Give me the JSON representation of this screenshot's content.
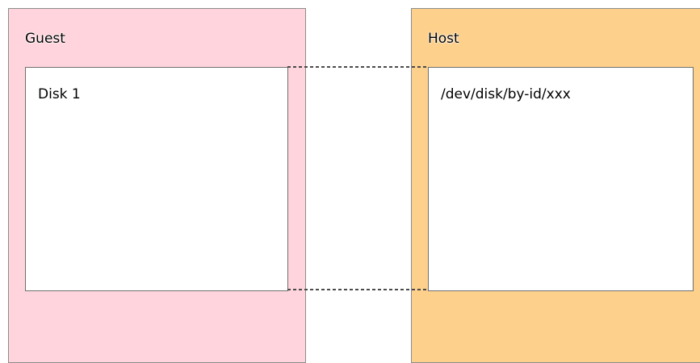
{
  "guest": {
    "title": "Guest",
    "disk_label": "Disk 1",
    "color": "#ffd4dc"
  },
  "host": {
    "title": "Host",
    "disk_label": "/dev/disk/by-id/xxx",
    "color": "#fdd08c"
  },
  "connector_color": "#4a4a4a"
}
